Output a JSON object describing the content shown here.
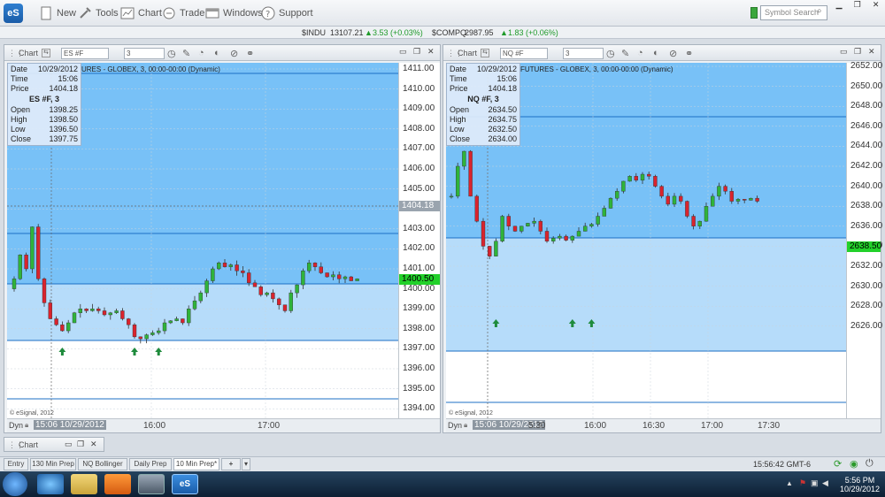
{
  "toolbar": {
    "logo": "eS",
    "new": "New",
    "tools": "Tools",
    "chart": "Chart",
    "trade": "Trade",
    "windows": "Windows",
    "support": "Support",
    "search_placeholder": "Symbol Search"
  },
  "quotes": [
    {
      "symbol": "$INDU",
      "price": "13107.21",
      "change": "3.53 (+0.03%)"
    },
    {
      "symbol": "$COMPQ",
      "price": "2987.95",
      "change": "1.83 (+0.06%)"
    }
  ],
  "colors": {
    "up": "#2fb33a",
    "down": "#d9232d",
    "upper_zone": "#78c1f7",
    "lower_zone": "#b6dcfa",
    "current_price": "#22d12a"
  },
  "chart1": {
    "title": "Chart",
    "symbol_value": "ES #F",
    "interval_value": "3",
    "subtitle": "URES - GLOBEX, 3, 00:00-00:00 (Dynamic)",
    "info": {
      "date_label": "Date",
      "date": "10/29/2012",
      "time_label": "Time",
      "time": "15:06",
      "price_label": "Price",
      "price": "1404.18",
      "header": "ES #F, 3",
      "open_label": "Open",
      "open": "1398.25",
      "high_label": "High",
      "high": "1398.50",
      "low_label": "Low",
      "low": "1396.50",
      "close_label": "Close",
      "close": "1397.75"
    },
    "y_ticks": [
      "1411.00",
      "1410.00",
      "1409.00",
      "1408.00",
      "1407.00",
      "1406.00",
      "1405.00",
      "1404.00",
      "1403.00",
      "1402.00",
      "1401.00",
      "1400.00",
      "1399.00",
      "1398.00",
      "1397.00",
      "1396.00",
      "1395.00",
      "1394.00"
    ],
    "crosshair_price": "1404.18",
    "last_price": "1400.50",
    "x_labels": [
      "16:00",
      "17:00"
    ],
    "cursor_label": "15:06 10/29/2012",
    "dyn": "Dyn",
    "copyright": "© eSignal, 2012"
  },
  "chart2": {
    "title": "Chart",
    "symbol_value": "NQ #F",
    "interval_value": "3",
    "subtitle": "FUTURES - GLOBEX, 3, 00:00-00:00 (Dynamic)",
    "info": {
      "date_label": "Date",
      "date": "10/29/2012",
      "time_label": "Time",
      "time": "15:06",
      "price_label": "Price",
      "price": "1404.18",
      "header": "NQ #F, 3",
      "open_label": "Open",
      "open": "2634.50",
      "high_label": "High",
      "high": "2634.75",
      "low_label": "Low",
      "low": "2632.50",
      "close_label": "Close",
      "close": "2634.00"
    },
    "y_ticks": [
      "2652.00",
      "2650.00",
      "2648.00",
      "2646.00",
      "2644.00",
      "2642.00",
      "2640.00",
      "2638.00",
      "2636.00",
      "2634.00",
      "2632.00",
      "2630.00",
      "2628.00",
      "2626.00"
    ],
    "last_price": "2638.50",
    "x_labels": [
      "5:30",
      "16:00",
      "16:30",
      "17:00",
      "17:30"
    ],
    "cursor_label": "15:06 10/29/2012",
    "dyn": "Dyn",
    "copyright": "© eSignal, 2012"
  },
  "minimized": {
    "title": "Chart"
  },
  "tabs": [
    "Entry",
    "130 Min Prep",
    "NQ Bollinger",
    "Daily Prep",
    "10 Min Prep*",
    "+"
  ],
  "status": {
    "time": "15:56:42 GMT-6"
  },
  "taskbar": {
    "time": "5:56 PM",
    "date": "10/29/2012"
  }
}
